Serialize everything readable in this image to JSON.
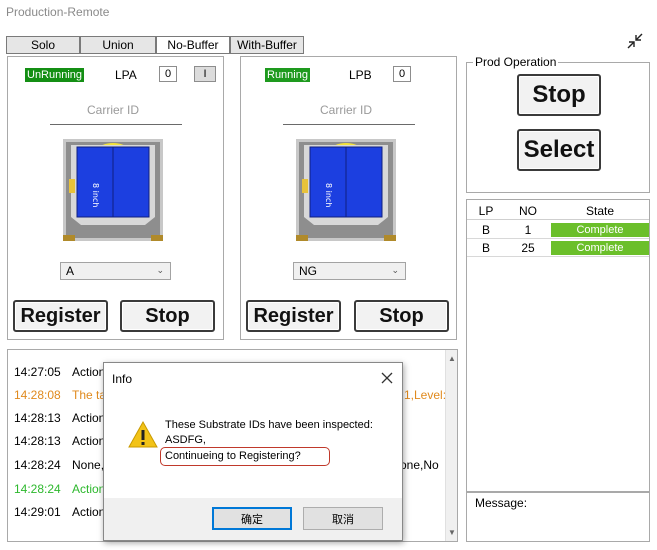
{
  "window": {
    "title": "Production-Remote"
  },
  "tabs": [
    "Solo",
    "Union",
    "No-Buffer",
    "With-Buffer"
  ],
  "lp_a": {
    "status": "UnRunning",
    "label": "LPA",
    "count": "0",
    "flag": "I",
    "carrier_label": "Carrier ID",
    "wafer_text": "8 inch",
    "selected": "A",
    "register_label": "Register",
    "stop_label": "Stop"
  },
  "lp_b": {
    "status": "Running",
    "label": "LPB",
    "count": "0",
    "carrier_label": "Carrier ID",
    "wafer_text": "8 inch",
    "selected": "NG",
    "register_label": "Register",
    "stop_label": "Stop"
  },
  "prod_operation": {
    "title": "Prod Operation",
    "stop_label": "Stop",
    "select_label": "Select"
  },
  "state_table": {
    "headers": [
      "LP",
      "NO",
      "State"
    ],
    "rows": [
      {
        "lp": "B",
        "no": "1",
        "state": "Complete"
      },
      {
        "lp": "B",
        "no": "25",
        "state": "Complete"
      }
    ]
  },
  "message": {
    "label": "Message:"
  },
  "log": {
    "entries": [
      {
        "time": "14:27:05",
        "text": "Action",
        "color": "#000000"
      },
      {
        "time": "14:28:08",
        "text": "The ta",
        "right": "1,Level:",
        "color": "#e08a1e"
      },
      {
        "time": "14:28:13",
        "text": "Action",
        "color": "#000000"
      },
      {
        "time": "14:28:13",
        "text": "Action",
        "color": "#000000"
      },
      {
        "time": "14:28:24",
        "text": "None,",
        "right": "one,No",
        "color": "#000000"
      },
      {
        "time": "14:28:24",
        "text": "Action",
        "color": "#2db82d"
      },
      {
        "time": "14:29:01",
        "text": "Action",
        "color": "#000000"
      }
    ]
  },
  "dialog": {
    "title": "Info",
    "line1": "These Substrate IDs have been inspected:",
    "line2": "ASDFG,",
    "line3": "Continueing to Registering?",
    "ok_label": "确定",
    "cancel_label": "取消"
  },
  "colors": {
    "running_green": "#1e9a1e",
    "complete_green": "#6bbf2a",
    "wafer_blue": "#1c3fe0",
    "warning_orange": "#e08a1e",
    "highlight_red": "#c0392b"
  }
}
